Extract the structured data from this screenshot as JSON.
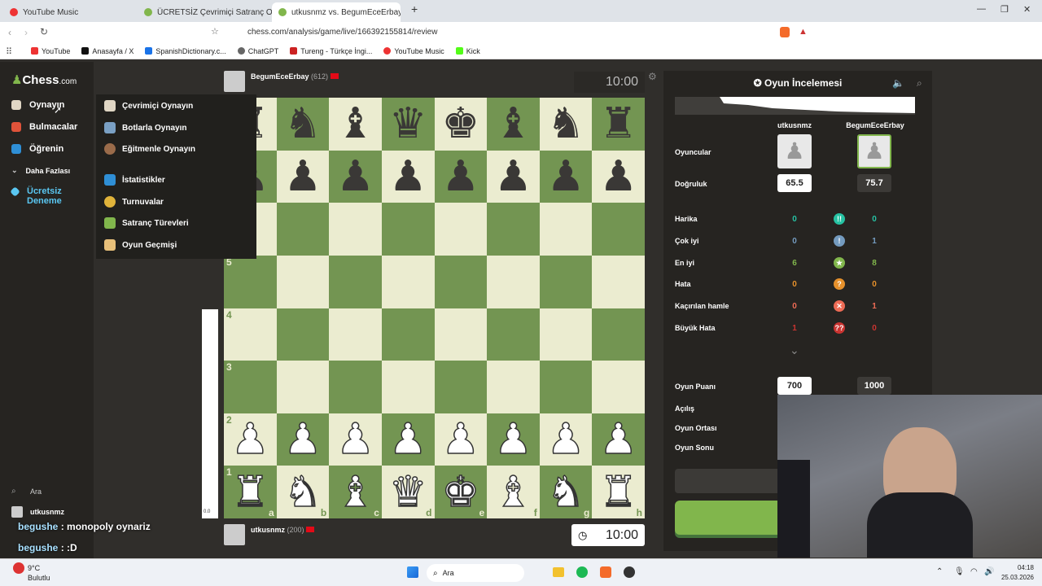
{
  "browser": {
    "tabs": [
      {
        "label": "YouTube Music"
      },
      {
        "label": "ÜCRETSİZ Çevrimiçi Satranç Oyunu..."
      },
      {
        "label": "utkusnmz vs. BegumEceErbay | A..."
      }
    ],
    "url": "chess.com/analysis/game/live/166392155814/review",
    "bookmarks": [
      "YouTube",
      "Anasayfa / X",
      "SpanishDictionary.c...",
      "ChatGPT",
      "Tureng - Türkçe İngi...",
      "YouTube Music",
      "Kick"
    ]
  },
  "nav": {
    "logo": "Chess",
    "logo_suffix": ".com",
    "items": [
      "Oynayın",
      "Bulmacalar",
      "Öğrenin",
      "Daha Fazlası",
      "Ücretsiz Deneme"
    ],
    "search": "Ara",
    "username": "utkusnmz"
  },
  "play_menu": {
    "items": [
      "Çevrimiçi Oynayın",
      "Botlarla Oynayın",
      "Eğitmenle Oynayın",
      "İstatistikler",
      "Turnuvalar",
      "Satranç Türevleri",
      "Oyun Geçmişi"
    ]
  },
  "game": {
    "top_player": {
      "name": "BegumEceErbay",
      "rating": "(612)",
      "clock": "10:00"
    },
    "bottom_player": {
      "name": "utkusnmz",
      "rating": "(200)",
      "clock": "10:00"
    },
    "eval": "0.0",
    "ranks": [
      "8",
      "7",
      "6",
      "5",
      "4",
      "3",
      "2",
      "1"
    ],
    "files": [
      "a",
      "b",
      "c",
      "d",
      "e",
      "f",
      "g",
      "h"
    ],
    "position": [
      [
        "r",
        "n",
        "b",
        "q",
        "k",
        "b",
        "n",
        "r"
      ],
      [
        "p",
        "p",
        "p",
        "p",
        "p",
        "p",
        "p",
        "p"
      ],
      [
        "",
        "",
        "",
        "",
        "",
        "",
        "",
        ""
      ],
      [
        "",
        "",
        "",
        "",
        "",
        "",
        "",
        ""
      ],
      [
        "",
        "",
        "",
        "",
        "",
        "",
        "",
        ""
      ],
      [
        "",
        "",
        "",
        "",
        "",
        "",
        "",
        ""
      ],
      [
        "P",
        "P",
        "P",
        "P",
        "P",
        "P",
        "P",
        "P"
      ],
      [
        "R",
        "N",
        "B",
        "Q",
        "K",
        "B",
        "N",
        "R"
      ]
    ]
  },
  "review": {
    "title": "Oyun İncelemesi",
    "white_name": "utkusnmz",
    "black_name": "BegumEceErbay",
    "players_label": "Oyuncular",
    "accuracy_label": "Doğruluk",
    "accuracy_white": "65.5",
    "accuracy_black": "75.7",
    "classifications": [
      {
        "label": "Harika",
        "white": "0",
        "black": "0",
        "icon": "!!",
        "color": "#26c2a3"
      },
      {
        "label": "Çok iyi",
        "white": "0",
        "black": "1",
        "icon": "!",
        "color": "#749bbf"
      },
      {
        "label": "En iyi",
        "white": "6",
        "black": "8",
        "icon": "★",
        "color": "#81b64c"
      },
      {
        "label": "Hata",
        "white": "0",
        "black": "0",
        "icon": "?",
        "color": "#e6912c"
      },
      {
        "label": "Kaçırılan hamle",
        "white": "0",
        "black": "1",
        "icon": "✕",
        "color": "#ee6b55"
      },
      {
        "label": "Büyük Hata",
        "white": "1",
        "black": "0",
        "icon": "??",
        "color": "#ca3431"
      }
    ],
    "rating_label": "Oyun Puanı",
    "rating_white": "700",
    "rating_black": "1000",
    "phases": [
      "Açılış",
      "Oyun Ortası",
      "Oyun Sonu"
    ],
    "review_button": "İncele"
  },
  "chat": [
    {
      "user": "begushe",
      "msg": ": monopoly oynariz"
    },
    {
      "user": "begushe",
      "msg": ": :D"
    }
  ],
  "taskbar": {
    "weather_temp": "9°C",
    "weather_desc": "Bulutlu",
    "search": "Ara",
    "time": "04:18",
    "date": "25.03.2026"
  }
}
